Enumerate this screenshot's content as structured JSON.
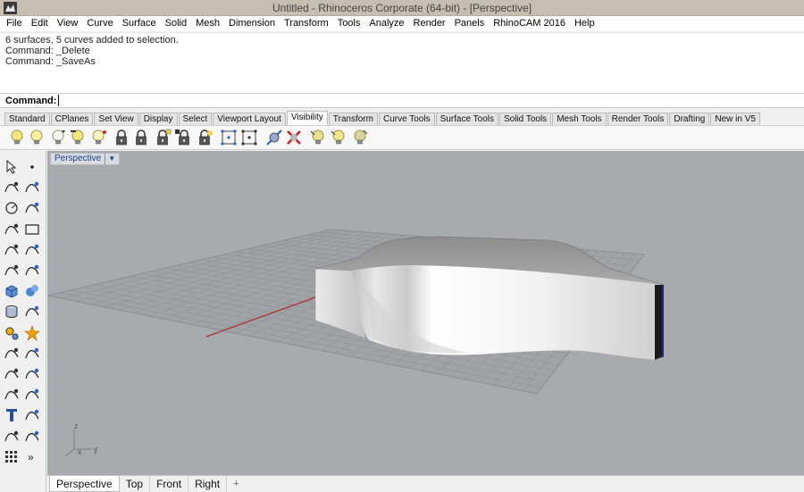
{
  "window": {
    "title": "Untitled - Rhinoceros Corporate (64-bit) - [Perspective]"
  },
  "menu": [
    "File",
    "Edit",
    "View",
    "Curve",
    "Surface",
    "Solid",
    "Mesh",
    "Dimension",
    "Transform",
    "Tools",
    "Analyze",
    "Render",
    "Panels",
    "RhinoCAM 2016",
    "Help"
  ],
  "command_history": [
    "6 surfaces, 5 curves added to selection.",
    "Command: _Delete",
    "Command: _SaveAs"
  ],
  "command_prompt": {
    "label": "Command:",
    "value": ""
  },
  "toolbar_tabs": [
    {
      "label": "Standard",
      "active": false
    },
    {
      "label": "CPlanes",
      "active": false
    },
    {
      "label": "Set View",
      "active": false
    },
    {
      "label": "Display",
      "active": false
    },
    {
      "label": "Select",
      "active": false
    },
    {
      "label": "Viewport Layout",
      "active": false
    },
    {
      "label": "Visibility",
      "active": true
    },
    {
      "label": "Transform",
      "active": false
    },
    {
      "label": "Curve Tools",
      "active": false
    },
    {
      "label": "Surface Tools",
      "active": false
    },
    {
      "label": "Solid Tools",
      "active": false
    },
    {
      "label": "Mesh Tools",
      "active": false
    },
    {
      "label": "Render Tools",
      "active": false
    },
    {
      "label": "Drafting",
      "active": false
    },
    {
      "label": "New in V5",
      "active": false
    }
  ],
  "visibility_icons": [
    "show-objects-icon",
    "hide-objects-icon",
    "show-selected-icon",
    "swap-hidden-icon",
    "hide-swap-icon",
    "lock-objects-icon",
    "unlock-objects-icon",
    "unlock-selected-icon",
    "lock-swap-icon",
    "lock-swap-alt-icon",
    "show-points-icon",
    "hide-points-icon",
    "show-edges-icon",
    "hide-edges-icon",
    "show-lights-icon",
    "hide-lights-icon",
    "lights-swap-icon"
  ],
  "viewport": {
    "name": "Perspective",
    "axis_labels": {
      "z": "z",
      "x": "x",
      "y": "y"
    }
  },
  "viewport_tabs": [
    {
      "label": "Perspective",
      "active": true
    },
    {
      "label": "Top",
      "active": false
    },
    {
      "label": "Front",
      "active": false
    },
    {
      "label": "Right",
      "active": false
    },
    {
      "label": "+",
      "active": false
    }
  ],
  "colors": {
    "viewport_bg": "#a7aaae",
    "grid_line": "#8e9196",
    "x_axis": "#b03030",
    "y_axis": "#4a8a4a",
    "link": "#1a3f8a"
  }
}
